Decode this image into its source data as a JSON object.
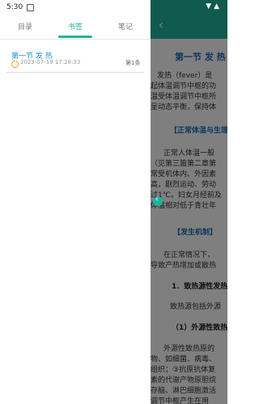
{
  "status_bar": {
    "time": "5:30",
    "icons": "▼ ▲"
  },
  "drawer": {
    "tabs": [
      {
        "label": "目录"
      },
      {
        "label": "书签"
      },
      {
        "label": "笔记"
      }
    ],
    "active_tab": "书签",
    "bookmarks": [
      {
        "title": "第一节 发 热",
        "time": "2023-07-19 17:28:33",
        "count": "第1条"
      }
    ]
  },
  "reader": {
    "back_icon": "‹",
    "chapter_title": "第一节 发 热",
    "lines": [
      "发热（fever）是",
      "起体温调节中枢的功",
      "温受体温调节中枢所",
      "呈动态平衡，保持体"
    ],
    "section1": "【正常体温与生理",
    "lines2": [
      "正常人体温一般",
      "（见第三篇第二章第",
      "常受机体内、外因素",
      "高，剧烈运动、劳动",
      "过1℃。妇女月经前及",
      "体温相对低于青壮年"
    ],
    "section2": "【发生机制】",
    "lines3": [
      "在正常情况下，",
      "导致产热增加或散热"
    ],
    "sub1": "1．致热源性发热",
    "line4": "致热源包括外源",
    "sub2": "（1）外源性致热",
    "lines5": [
      "外源性致热原的",
      "物、如细菌、病毒、",
      "组织；③抗原抗体复",
      "素的代谢产物原胆烷",
      "存脑、淋巴细胞激活",
      "调节中枢产生在用"
    ]
  },
  "drawer_handle_icon": "‹"
}
